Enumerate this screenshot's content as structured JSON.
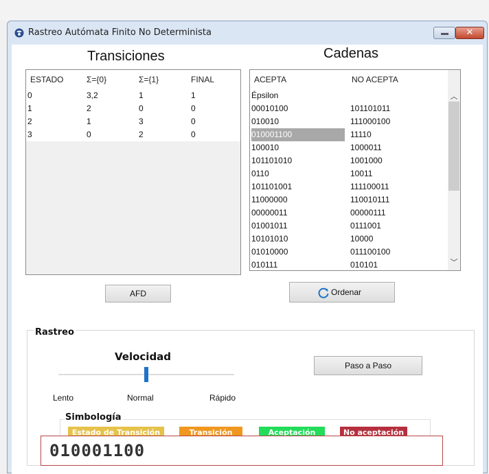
{
  "window": {
    "title": "Rastreo Autómata Finito No Determinista"
  },
  "transiciones": {
    "heading": "Transiciones",
    "columns": [
      "ESTADO",
      "Σ={0}",
      "Σ={1}",
      "FINAL"
    ],
    "rows": [
      [
        "0",
        "3,2",
        "1",
        "1"
      ],
      [
        "1",
        "2",
        "0",
        "0"
      ],
      [
        "2",
        "1",
        "3",
        "0"
      ],
      [
        "3",
        "0",
        "2",
        "0"
      ]
    ]
  },
  "cadenas": {
    "heading": "Cadenas",
    "columns": [
      "ACEPTA",
      "NO ACEPTA"
    ],
    "rows": [
      [
        "Épsilon",
        ""
      ],
      [
        "00010100",
        "101101011"
      ],
      [
        "010010",
        "111000100"
      ],
      [
        "010001100",
        "11110"
      ],
      [
        "100010",
        "1000011"
      ],
      [
        "101101010",
        "1001000"
      ],
      [
        "0110",
        "10011"
      ],
      [
        "101101001",
        "111100011"
      ],
      [
        "11000000",
        "110010111"
      ],
      [
        "00000011",
        "00000111"
      ],
      [
        "01001011",
        "0111001"
      ],
      [
        "10101010",
        "10000"
      ],
      [
        "01010000",
        "011100100"
      ],
      [
        "010111",
        "010101"
      ]
    ],
    "selected_row": 3
  },
  "buttons": {
    "afd": "AFD",
    "ordenar": "Ordenar",
    "paso_a_paso": "Paso a Paso"
  },
  "rastreo": {
    "label": "Rastreo",
    "velocidad_label": "Velocidad",
    "slider": {
      "min_label": "Lento",
      "mid_label": "Normal",
      "max_label": "Rápido",
      "value": 0.5
    },
    "simbologia": {
      "label": "Simbología",
      "items": [
        {
          "label": "Estado de Transición",
          "color": "#e5c24a"
        },
        {
          "label": "Transición",
          "color": "#f0971f"
        },
        {
          "label": "Aceptación",
          "color": "#22dc5a"
        },
        {
          "label": "No aceptación",
          "color": "#b5303e"
        }
      ]
    }
  },
  "current_string": "010001100",
  "colors": {
    "accent": "#1e73c8",
    "window_frame": "#dbe6f4",
    "close_button": "#c2472f"
  }
}
